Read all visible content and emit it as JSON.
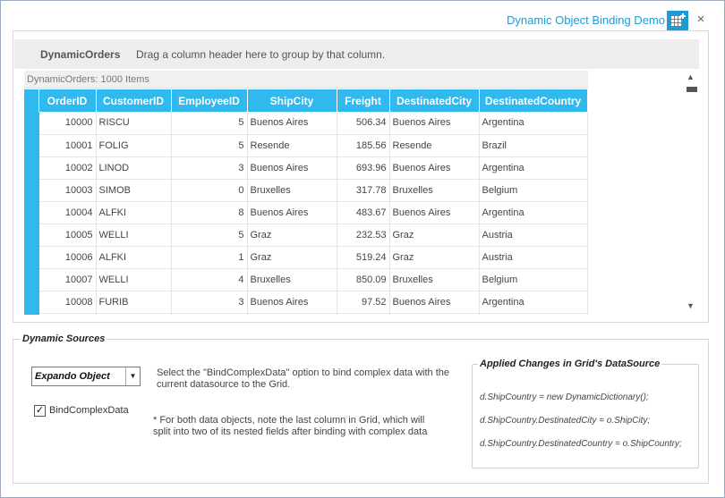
{
  "window": {
    "title": "Dynamic Object Binding Demo",
    "close_glyph": "×",
    "icon": "grid-settings-icon"
  },
  "grid": {
    "group_name": "DynamicOrders",
    "group_hint": "Drag a column header here to group by that column.",
    "items_label": "DynamicOrders: 1000 Items",
    "columns": [
      "OrderID",
      "CustomerID",
      "EmployeeID",
      "ShipCity",
      "Freight",
      "DestinatedCity",
      "DestinatedCountry"
    ],
    "rows": [
      [
        "10000",
        "RISCU",
        "5",
        "Buenos Aires",
        "506.34",
        "Buenos Aires",
        "Argentina"
      ],
      [
        "10001",
        "FOLIG",
        "5",
        "Resende",
        "185.56",
        "Resende",
        "Brazil"
      ],
      [
        "10002",
        "LINOD",
        "3",
        "Buenos Aires",
        "693.96",
        "Buenos Aires",
        "Argentina"
      ],
      [
        "10003",
        "SIMOB",
        "0",
        "Bruxelles",
        "317.78",
        "Bruxelles",
        "Belgium"
      ],
      [
        "10004",
        "ALFKI",
        "8",
        "Buenos Aires",
        "483.67",
        "Buenos Aires",
        "Argentina"
      ],
      [
        "10005",
        "WELLI",
        "5",
        "Graz",
        "232.53",
        "Graz",
        "Austria"
      ],
      [
        "10006",
        "ALFKI",
        "1",
        "Graz",
        "519.24",
        "Graz",
        "Austria"
      ],
      [
        "10007",
        "WELLI",
        "4",
        "Bruxelles",
        "850.09",
        "Bruxelles",
        "Belgium"
      ],
      [
        "10008",
        "FURIB",
        "3",
        "Buenos Aires",
        "97.52",
        "Buenos Aires",
        "Argentina"
      ]
    ]
  },
  "sources": {
    "legend": "Dynamic Sources",
    "dropdown_value": "Expando Object",
    "checkbox_label": "BindComplexData",
    "checkbox_checked": true,
    "description1": "Select the  \"BindComplexData\" option to bind complex data with the current datasource to the Grid.",
    "description2": " * For both data objects, note the last column in Grid, which will split into two of its nested fields after binding with complex data",
    "changes_title": "Applied Changes in Grid's DataSource",
    "code_lines": [
      "d.ShipCountry = new DynamicDictionary();",
      "d.ShipCountry.DestinatedCity = o.ShipCity;",
      "d.ShipCountry.DestinatedCountry = o.ShipCountry;"
    ]
  },
  "colors": {
    "accent": "#2fb9ee",
    "title": "#1e9ad6"
  }
}
